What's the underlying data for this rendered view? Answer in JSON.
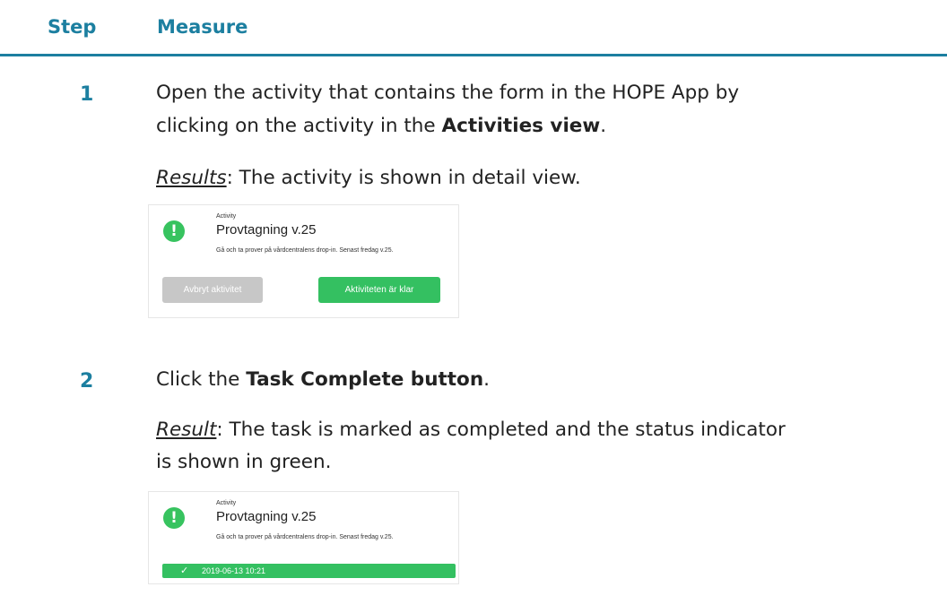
{
  "header": {
    "step": "Step",
    "measure": "Measure"
  },
  "steps": [
    {
      "number": "1",
      "line1": "Open the activity that contains the form in the HOPE App by",
      "line2_pre": "clicking on the activity in the ",
      "line2_bold": "Activities view",
      "line2_post": ".",
      "result_label": "Results",
      "result_text": ": The activity is shown in detail view.",
      "card": {
        "kicker": "Activity",
        "title": "Provtagning v.25",
        "description": "Gå och ta prover på vårdcentralens drop-in. Senast fredag v.25.",
        "cancel_label": "Avbryt aktivitet",
        "done_label": "Aktiviteten är klar"
      }
    },
    {
      "number": "2",
      "line1_pre": "Click the ",
      "line1_bold": "Task Complete button",
      "line1_post": ".",
      "result_label": "Result",
      "result_text": ": The task is marked as completed and the status indicator",
      "result_line2": "is shown in green.",
      "card": {
        "kicker": "Activity",
        "title": "Provtagning v.25",
        "description": "Gå och ta prover på vårdcentralens drop-in. Senast fredag v.25.",
        "check_icon": "check-icon",
        "timestamp": "2019-06-13 10:21"
      }
    }
  ],
  "colors": {
    "accent": "#1c7fa0",
    "success": "#34c061",
    "disabled": "#c7c7c7"
  }
}
